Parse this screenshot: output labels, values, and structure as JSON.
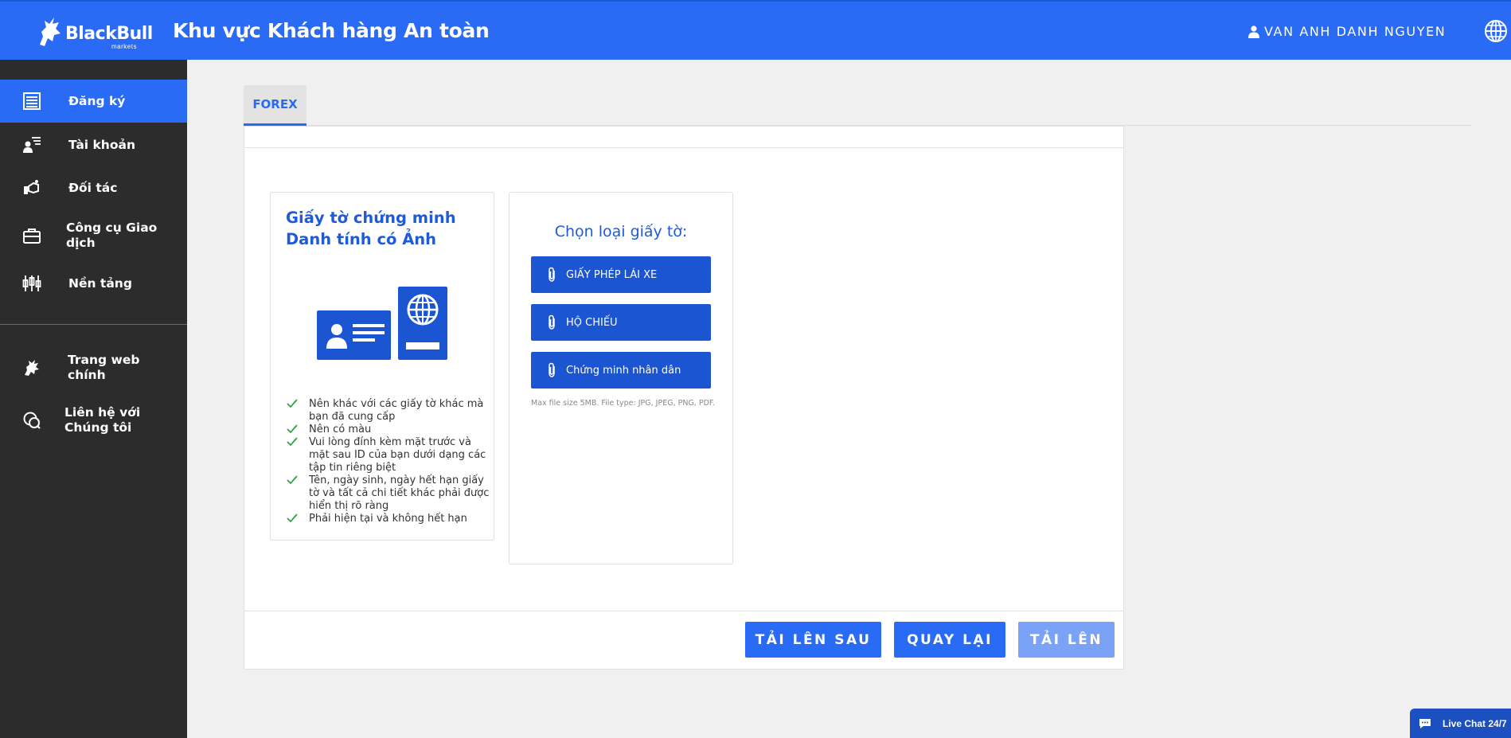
{
  "header": {
    "logo_text": "BlackBull",
    "logo_sub": "markets",
    "title": "Khu vực Khách hàng An toàn",
    "user_name": "VAN ANH DANH NGUYEN"
  },
  "sidebar": {
    "items": [
      {
        "label": "Đăng ký",
        "icon": "register-icon"
      },
      {
        "label": "Tài khoản",
        "icon": "account-icon"
      },
      {
        "label": "Đối tác",
        "icon": "partner-icon"
      },
      {
        "label": "Công cụ Giao dịch",
        "icon": "briefcase-icon"
      },
      {
        "label": "Nền tảng",
        "icon": "platform-icon"
      },
      {
        "label": "Trang web chính",
        "icon": "bull-icon"
      },
      {
        "label": "Liên hệ với Chúng tôi",
        "icon": "chat-bubble-icon"
      }
    ],
    "active_index": 0
  },
  "tabs": {
    "forex": "FOREX"
  },
  "id_card": {
    "title": "Giấy tờ chứng minh Danh tính có Ảnh",
    "requirements": [
      "Nên khác với các giấy tờ khác mà bạn đã cung cấp",
      "Nên có màu",
      "Vui lòng đính kèm mặt trước và mặt sau ID của bạn dưới dạng các tập tin riêng biệt",
      "Tên, ngày sinh, ngày hết hạn giấy tờ và tất cả chi tiết khác phải được hiển thị rõ ràng",
      "Phải hiện tại và không hết hạn"
    ]
  },
  "doc_select": {
    "title": "Chọn loại giấy tờ:",
    "options": [
      "GIẤY PHÉP LÁI XE",
      "HỘ CHIẾU",
      "Chứng minh nhân dân"
    ],
    "note": "Max file size 5MB. File type: JPG, JPEG, PNG, PDF."
  },
  "actions": {
    "upload_later": "TẢI LÊN SAU",
    "back": "QUAY LẠI",
    "upload": "TẢI LÊN"
  },
  "live_chat": "Live Chat 24/7",
  "colors": {
    "primary": "#2a6bf6",
    "dark_blue": "#1c55d1",
    "sidebar": "#2c2c2c",
    "disabled": "#7aa3f7",
    "check": "#3aa13a"
  }
}
